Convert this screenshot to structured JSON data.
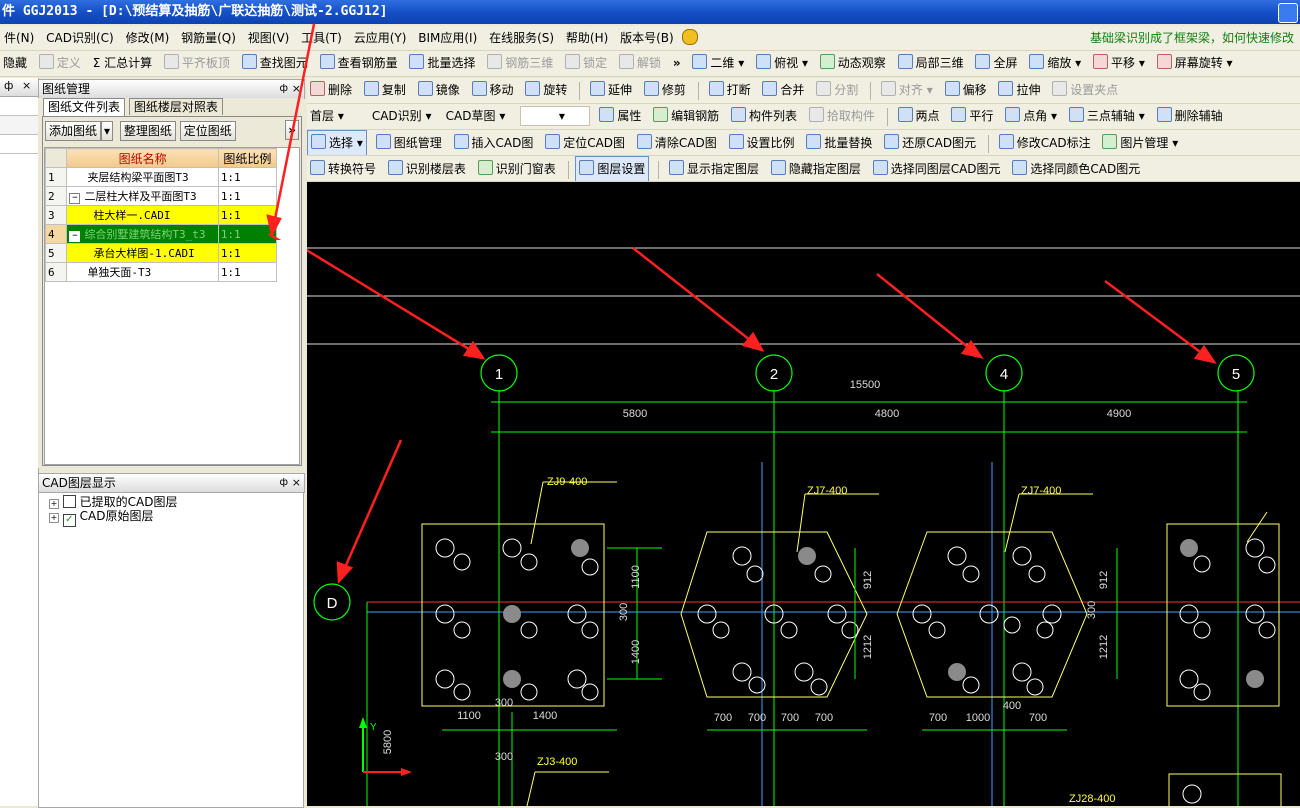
{
  "window": {
    "title": "件 GGJ2013 - [D:\\预结算及抽筋\\广联达抽筋\\测试-2.GGJ12]"
  },
  "menu": {
    "items": [
      "件(N)",
      "CAD识别(C)",
      "修改(M)",
      "钢筋量(Q)",
      "视图(V)",
      "工具(T)",
      "云应用(Y)",
      "BIM应用(I)",
      "在线服务(S)",
      "帮助(H)",
      "版本号(B)"
    ],
    "notice": "基础梁识别成了框架梁，如何快速修改"
  },
  "toolbar1": {
    "left": [
      "隐藏",
      "定义",
      "Σ 汇总计算",
      "平齐板顶",
      "查找图元",
      "查看钢筋量",
      "批量选择",
      "钢筋三维",
      "锁定",
      "解锁"
    ],
    "right": [
      "二维",
      "俯视",
      "动态观察",
      "局部三维",
      "全屏",
      "缩放",
      "平移",
      "屏幕旋转"
    ]
  },
  "toolbar2": [
    "删除",
    "复制",
    "镜像",
    "移动",
    "旋转",
    "延伸",
    "修剪",
    "打断",
    "合并",
    "分割",
    "对齐",
    "偏移",
    "拉伸",
    "设置夹点"
  ],
  "toolbar3": {
    "floor": "首层",
    "mode": "CAD识别",
    "sub": "CAD草图",
    "items": [
      "属性",
      "编辑钢筋",
      "构件列表",
      "拾取构件",
      "两点",
      "平行",
      "点角",
      "三点辅轴",
      "删除辅轴"
    ]
  },
  "toolbar4": [
    "选择",
    "图纸管理",
    "插入CAD图",
    "定位CAD图",
    "清除CAD图",
    "设置比例",
    "批量替换",
    "还原CAD图元",
    "修改CAD标注",
    "图片管理"
  ],
  "toolbar5": [
    "转换符号",
    "识别楼层表",
    "识别门窗表",
    "图层设置",
    "显示指定图层",
    "隐藏指定图层",
    "选择同图层CAD图元",
    "选择同颜色CAD图元"
  ],
  "left_stub": {
    "title": "",
    "pin": "ф",
    "close": "×"
  },
  "drawing_panel": {
    "title": "图纸管理",
    "tabs": [
      "图纸文件列表",
      "图纸楼层对照表"
    ],
    "buttons": [
      "添加图纸",
      "整理图纸",
      "定位图纸"
    ],
    "headers": [
      "图纸名称",
      "图纸比例"
    ],
    "rows": [
      {
        "n": "1",
        "name": "夹层结构梁平面图T3",
        "ratio": "1:1"
      },
      {
        "n": "2",
        "name": "二层柱大样及平面图T3",
        "ratio": "1:1"
      },
      {
        "n": "3",
        "name": "柱大样一.CADI",
        "ratio": "1:1"
      },
      {
        "n": "4",
        "name": "综合别墅建筑结构T3_t3",
        "ratio": "1:1"
      },
      {
        "n": "5",
        "name": "承台大样图-1.CADI",
        "ratio": "1:1"
      },
      {
        "n": "6",
        "name": "单独天面-T3",
        "ratio": "1:1"
      }
    ]
  },
  "layer_panel": {
    "title": "CAD图层显示",
    "items": [
      {
        "label": "已提取的CAD图层",
        "checked": false
      },
      {
        "label": "CAD原始图层",
        "checked": true
      }
    ]
  },
  "cad": {
    "axes": [
      "1",
      "2",
      "4",
      "5",
      "D"
    ],
    "total_dim": "15500",
    "spans": [
      "5800",
      "4800",
      "4900"
    ],
    "pile_caps": [
      "ZJ9-400",
      "ZJ7-400",
      "ZJ7-400",
      "ZJ3-400",
      "ZJ28-400"
    ],
    "dims": [
      "1100",
      "1400",
      "300",
      "1100",
      "1400",
      "300",
      "912",
      "1212",
      "912",
      "1212",
      "300",
      "700",
      "700",
      "700",
      "700",
      "700",
      "1000",
      "700",
      "400",
      "300",
      "5800"
    ],
    "axis_marker": "Y"
  },
  "colors": {
    "title_bar": "#1a56cc",
    "highlight_yellow": "#ffff00",
    "highlight_green": "#008000",
    "cad_bg": "#000000",
    "cad_green": "#00ff00",
    "cad_yellow": "#ffff33",
    "annotation_red": "#ff2020"
  }
}
